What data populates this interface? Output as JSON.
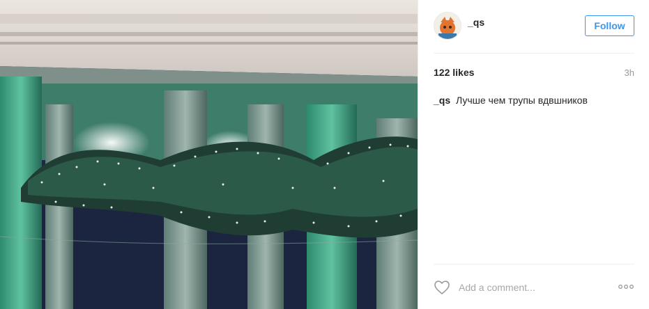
{
  "post": {
    "username": "_qs",
    "follow_label": "Follow",
    "likes": "122 likes",
    "time": "3h",
    "caption_user": "_qs",
    "caption_text": "Лучше чем трупы вдвшников",
    "comment_placeholder": "Add a comment...",
    "icons": {
      "heart": "heart-icon",
      "more": "more-options-icon"
    },
    "colors": {
      "accent": "#3897f0",
      "muted": "#999999",
      "text": "#262626"
    }
  }
}
